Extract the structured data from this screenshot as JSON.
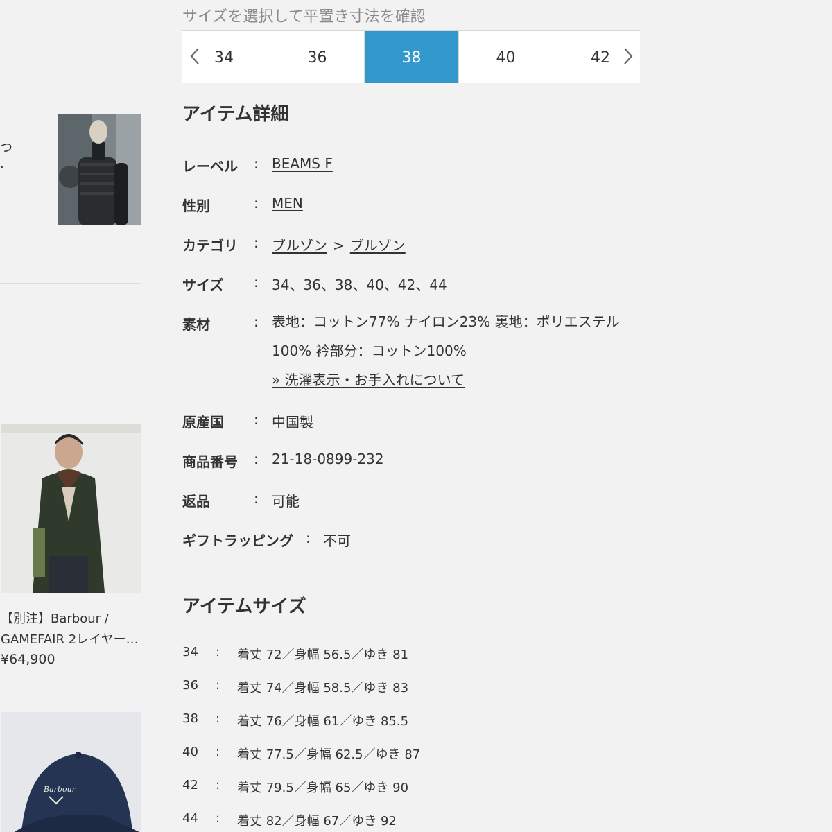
{
  "sidebar": {
    "fragment_line1": "つ",
    "fragment_line2": ".",
    "product1": {
      "name_line1": "【別注】Barbour /",
      "name_line2": "GAMEFAIR 2レイヤー…",
      "price": "¥64,900"
    },
    "product2": {
      "cap_logo": "Barbour"
    }
  },
  "size_selector": {
    "title": "サイズを選択して平置き寸法を確認",
    "tabs": [
      "34",
      "36",
      "38",
      "40",
      "42"
    ],
    "selected": "38",
    "prev_icon": "chevron-left-icon",
    "next_icon": "chevron-right-icon",
    "accent_color": "#3399cc"
  },
  "details": {
    "title": "アイテム詳細",
    "label": {
      "label": "レーベル",
      "colon": ":",
      "value": "BEAMS F"
    },
    "gender": {
      "label": "性別",
      "colon": ":",
      "value": "MEN"
    },
    "category": {
      "label": "カテゴリ",
      "colon": ":",
      "parent": "ブルゾン",
      "separator": ">",
      "child": "ブルゾン"
    },
    "size": {
      "label": "サイズ",
      "colon": ":",
      "value": "34、36、38、40、42、44"
    },
    "material": {
      "label": "素材",
      "colon": ":",
      "line1": "表地：コットン77% ナイロン23% 裏地：ポリエステル",
      "line2": "100% 衿部分：コットン100%",
      "care_link": "» 洗濯表示・お手入れについて"
    },
    "origin": {
      "label": "原産国",
      "colon": ":",
      "value": "中国製"
    },
    "product_number": {
      "label": "商品番号",
      "colon": ":",
      "value": "21-18-0899-232"
    },
    "returns": {
      "label": "返品",
      "colon": ":",
      "value": "可能"
    },
    "gift": {
      "label": "ギフトラッピング",
      "colon": ":",
      "value": "不可"
    }
  },
  "item_size": {
    "title": "アイテムサイズ",
    "colon": ":",
    "rows": [
      {
        "size": "34",
        "measure": "着丈 72／身幅 56.5／ゆき 81"
      },
      {
        "size": "36",
        "measure": "着丈 74／身幅 58.5／ゆき 83"
      },
      {
        "size": "38",
        "measure": "着丈 76／身幅 61／ゆき 85.5"
      },
      {
        "size": "40",
        "measure": "着丈 77.5／身幅 62.5／ゆき 87"
      },
      {
        "size": "42",
        "measure": "着丈 79.5／身幅 65／ゆき 90"
      },
      {
        "size": "44",
        "measure": "着丈 82／身幅 67／ゆき 92"
      }
    ]
  }
}
